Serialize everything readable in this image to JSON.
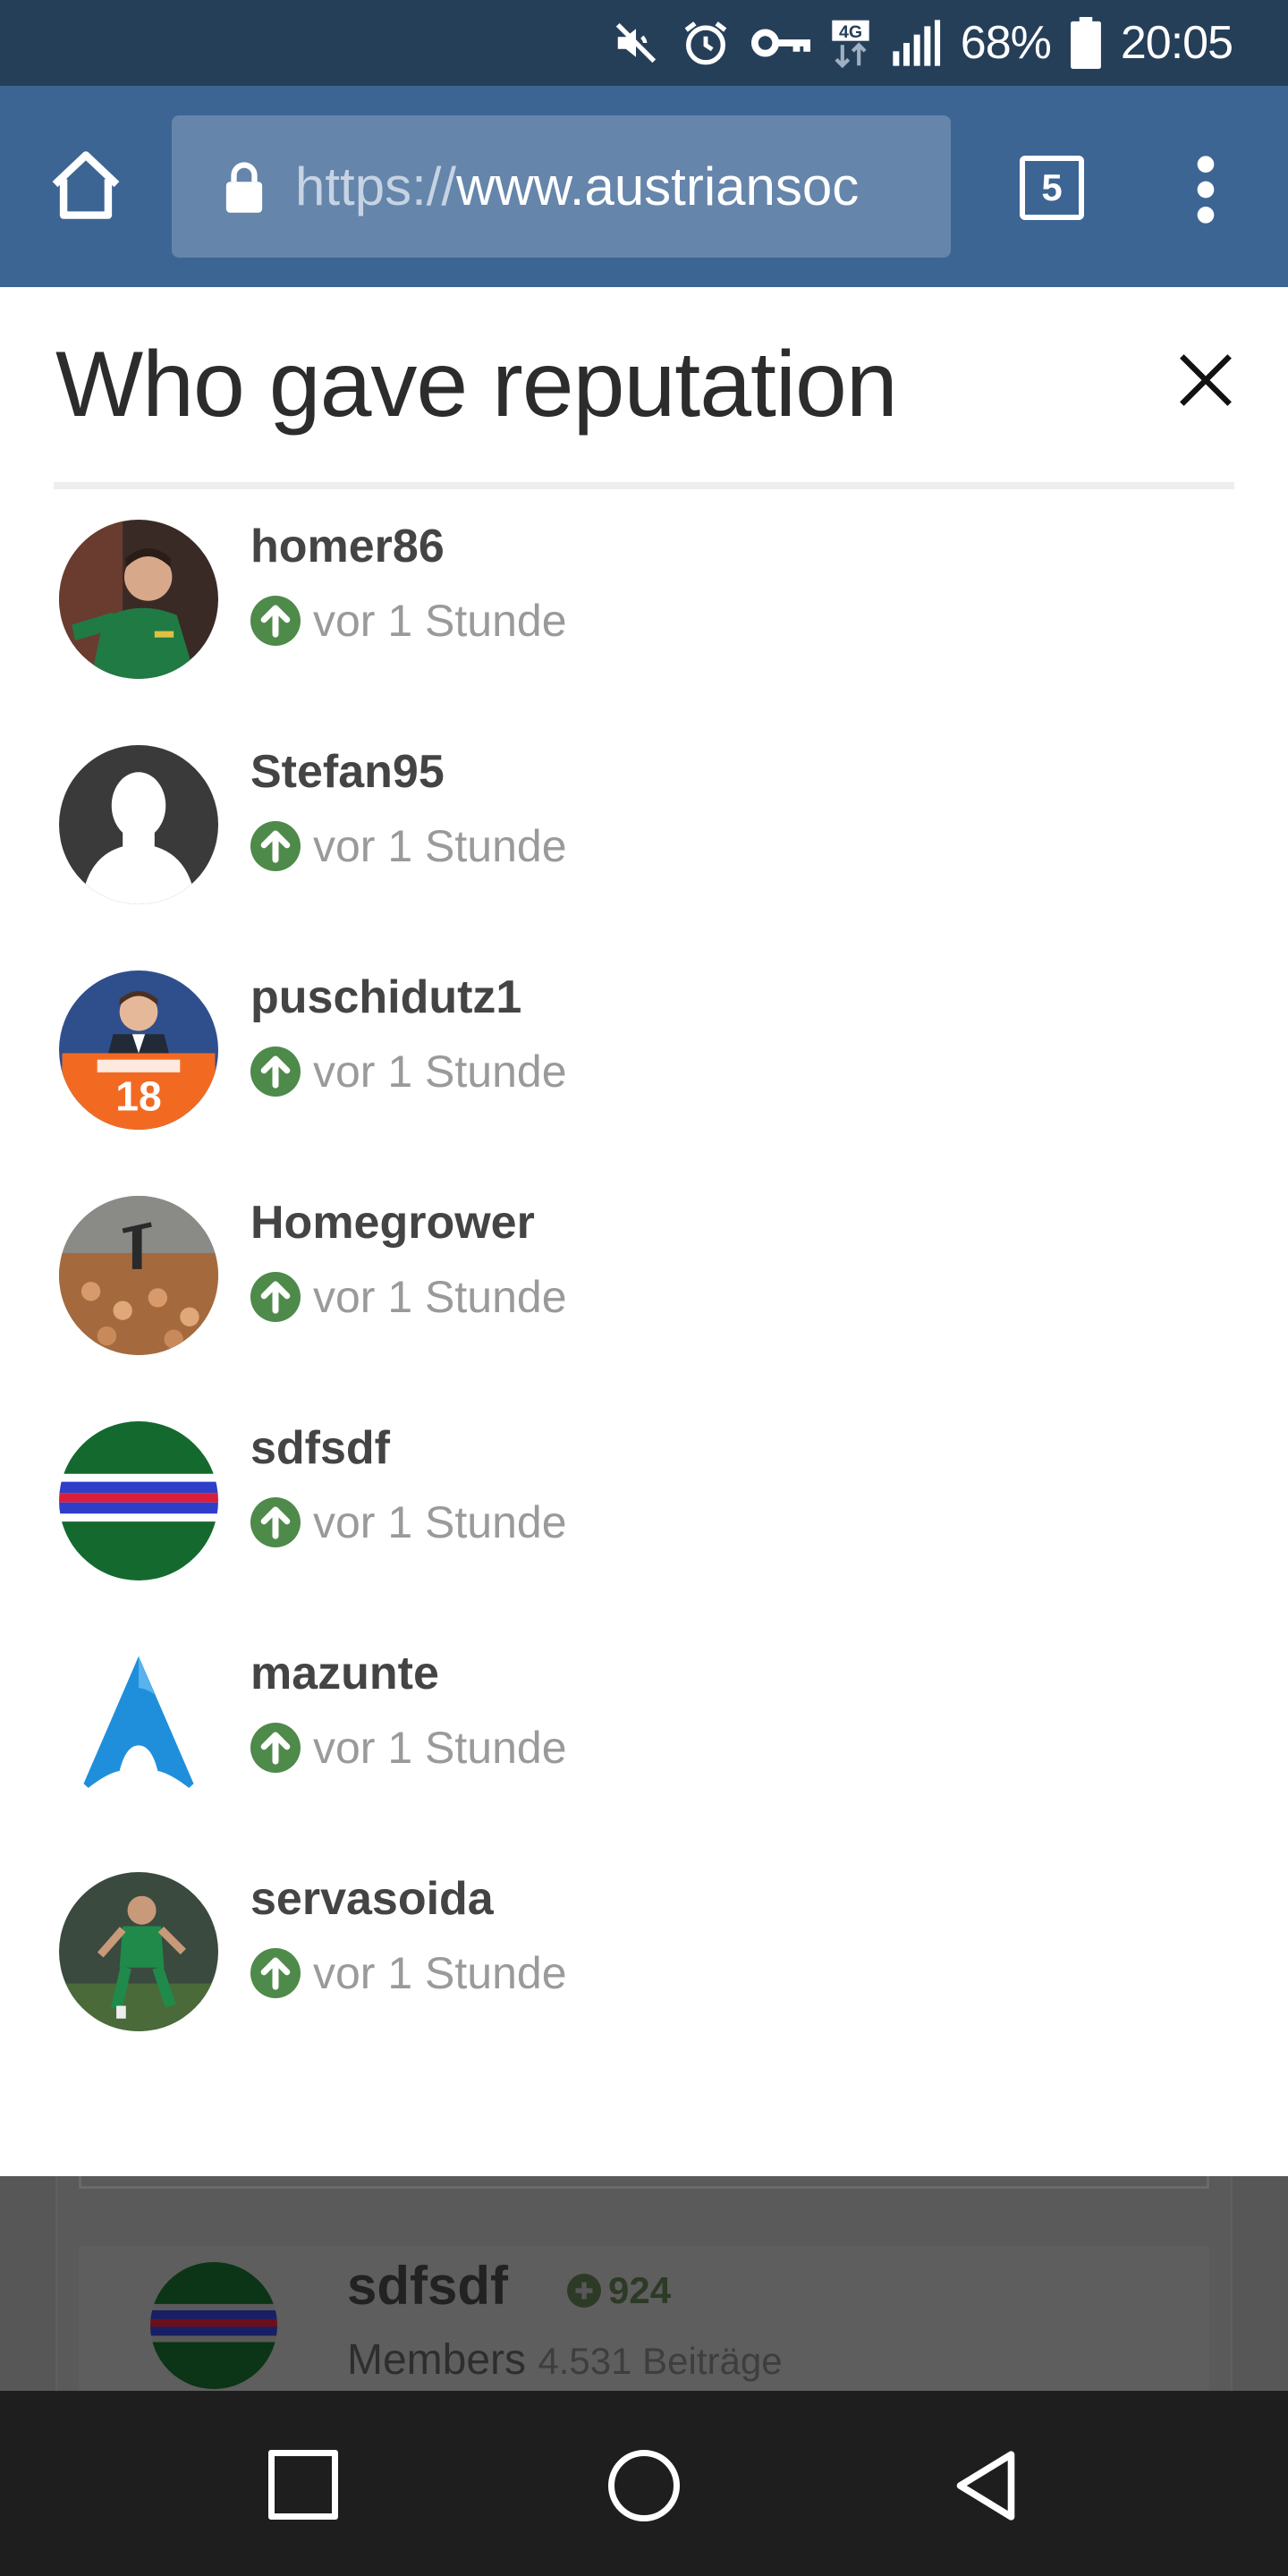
{
  "status_bar": {
    "network": "4G",
    "battery": "68%",
    "time": "20:05",
    "icons": [
      "mute-icon",
      "alarm-icon",
      "vpn-key-icon",
      "data-4g-icon",
      "signal-icon",
      "battery-icon"
    ]
  },
  "browser": {
    "url_scheme": "https://",
    "url_host": "www.austriansoc",
    "tab_count": "5",
    "icons": [
      "home-icon",
      "lock-icon",
      "tabs-icon",
      "overflow-menu-icon"
    ]
  },
  "modal": {
    "title": "Who gave reputation",
    "close_icon": "close-icon",
    "entries": [
      {
        "name": "homer86",
        "time": "vor 1 Stunde"
      },
      {
        "name": "Stefan95",
        "time": "vor 1 Stunde"
      },
      {
        "name": "puschidutz1",
        "time": "vor 1 Stunde"
      },
      {
        "name": "Homegrower",
        "time": "vor 1 Stunde"
      },
      {
        "name": "sdfsdf",
        "time": "vor 1 Stunde"
      },
      {
        "name": "mazunte",
        "time": "vor 1 Stunde"
      },
      {
        "name": "servasoida",
        "time": "vor 1 Stunde"
      }
    ],
    "reputation_icon": "arrow-up-circle-icon",
    "colors": {
      "upvote": "#4e8a4a",
      "title": "#2c2c2c",
      "name": "#444444",
      "time": "#9a9a9a"
    }
  },
  "background_post": {
    "author": "sdfsdf",
    "reputation": "924",
    "group": "Members",
    "post_count": "4.531 Beiträge"
  },
  "nav_bar": {
    "icons": [
      "recents-icon",
      "home-circle-icon",
      "back-icon"
    ]
  },
  "theme": {
    "status_bar": "#263f59",
    "toolbar": "#3c6593",
    "urlbar": "#6585ab"
  }
}
